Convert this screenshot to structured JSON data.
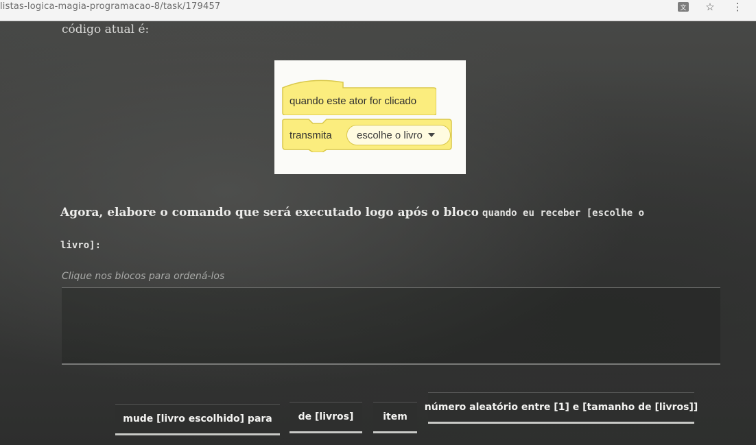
{
  "browser": {
    "url": "listas-logica-magia-programacao-8/task/179457",
    "icons": [
      "translate-icon",
      "star-icon",
      "kebab-menu-icon"
    ]
  },
  "content": {
    "intro": "código atual é:",
    "blocks": {
      "hat_label": "quando este ator for clicado",
      "command_label": "transmita",
      "dropdown_value": "escolhe o livro"
    },
    "question": {
      "text": "Agora, elabore o comando que será executado logo após o bloco",
      "code": "quando eu receber [escolhe o livro]",
      "suffix": ":"
    },
    "hint": "Clique nos blocos para ordená-los",
    "options": [
      "mude [livro escolhido] para",
      "de [livros]",
      "item",
      "número aleatório entre [1] e [tamanho de [livros]]"
    ]
  },
  "colors": {
    "board": "#3b3c3b",
    "block_yellow": "#fbed7e",
    "block_border": "#d9c84a",
    "text_light": "#ececea"
  }
}
